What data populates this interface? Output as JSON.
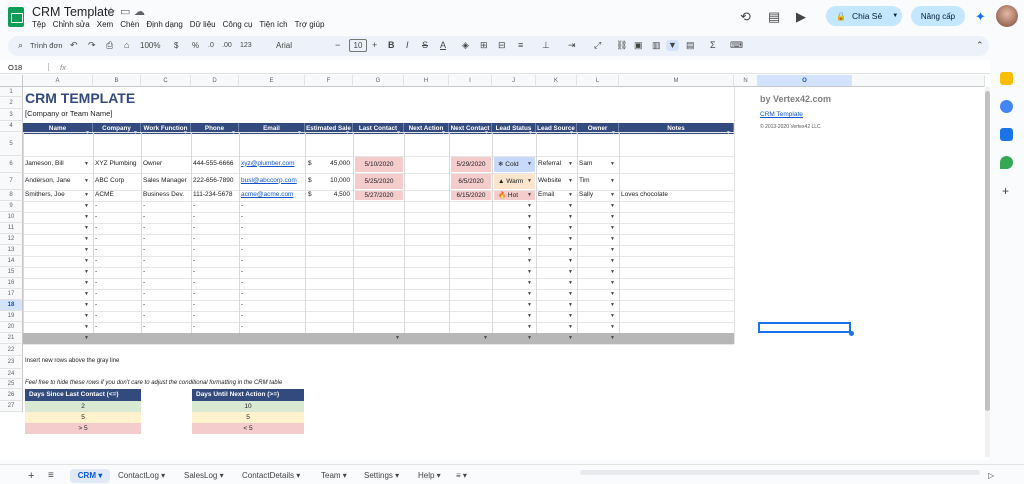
{
  "app": {
    "title": "CRM Template",
    "menu": [
      "Tệp",
      "Chỉnh sửa",
      "Xem",
      "Chèn",
      "Định dạng",
      "Dữ liệu",
      "Công cụ",
      "Tiện ích",
      "Trợ giúp"
    ],
    "share_label": "Chia Sẻ",
    "upgrade_label": "Nâng cấp"
  },
  "toolbar": {
    "search": "Trình đơn",
    "zoom": "100%",
    "currency": "$",
    "percent": "%",
    "decimal_dec": ".0",
    "decimal_inc": ".00",
    "number_format": "123",
    "font": "Arial",
    "font_size": "10"
  },
  "formula_bar": {
    "cell_ref": "O18",
    "fx": "fx",
    "content": ""
  },
  "columns": [
    "A",
    "B",
    "C",
    "D",
    "E",
    "F",
    "G",
    "H",
    "I",
    "J",
    "K",
    "L",
    "M",
    "N",
    "O"
  ],
  "rows": [
    "1",
    "2",
    "3",
    "4",
    "5",
    "6",
    "7",
    "8",
    "9",
    "10",
    "11",
    "12",
    "13",
    "14",
    "15",
    "16",
    "17",
    "18",
    "19",
    "20",
    "21",
    "22",
    "23",
    "24",
    "25",
    "26",
    "27"
  ],
  "sheet": {
    "title": "CRM TEMPLATE",
    "subtitle": "[Company or Team Name]",
    "brand": "by Vertex42.com",
    "brand_link": "CRM Template",
    "copyright": "© 2013-2020 Vertex42 LLC",
    "headers": [
      "Name",
      "Company",
      "Work Function",
      "Phone",
      "Email",
      "Estimated Sale",
      "Last Contact",
      "Next Action",
      "Next Contact",
      "Lead Status",
      "Lead Source",
      "Owner",
      "Notes"
    ],
    "records": [
      {
        "name": "Jameson, Bill",
        "company": "XYZ Plumbing",
        "work": "Owner",
        "phone": "444-555-6666",
        "email": "xyz@plumber.com",
        "currency": "$",
        "sale": "45,000",
        "last": "5/10/2020",
        "next_action": "",
        "next": "5/29/2020",
        "status": "Cold",
        "source": "Referral",
        "owner": "Sam",
        "notes": ""
      },
      {
        "name": "Anderson, Jane",
        "company": "ABC Corp",
        "work": "Sales Manager",
        "phone": "222-656-7890",
        "email": "busl@abccorp.com",
        "currency": "$",
        "sale": "10,000",
        "last": "5/25/2020",
        "next_action": "",
        "next": "6/5/2020",
        "status": "Warm",
        "source": "Website",
        "owner": "Tim",
        "notes": ""
      },
      {
        "name": "Smithers, Joe",
        "company": "ACME",
        "work": "Business Dev.",
        "phone": "111-234-5678",
        "email": "acme@acme.com",
        "currency": "$",
        "sale": "4,500",
        "last": "5/27/2020",
        "next_action": "",
        "next": "6/15/2020",
        "status": "Hot",
        "source": "Email",
        "owner": "Sally",
        "notes": "Loves chocolate"
      }
    ],
    "dash": "-",
    "insert_note": "Insert new rows above the gray line",
    "cf_note": "Feel free to hide these rows if you don't care to adjust the conditional formatting in the CRM table",
    "days_since": {
      "header": "Days Since Last Contact (<=)",
      "values": [
        "2",
        "5",
        "> 5"
      ]
    },
    "days_until": {
      "header": "Days Until Next Action (>=)",
      "values": [
        "10",
        "5",
        "< 5"
      ]
    }
  },
  "tabs": [
    "CRM",
    "ContactLog",
    "SalesLog",
    "ContactDetails",
    "Team",
    "Settings",
    "Help"
  ],
  "colors": {
    "header_blue": "#334a7e",
    "red": "#f4cccc",
    "blue": "#c9daf8",
    "orange": "#fce5cd",
    "green": "#d9ead3",
    "yellow": "#fff2cc"
  }
}
